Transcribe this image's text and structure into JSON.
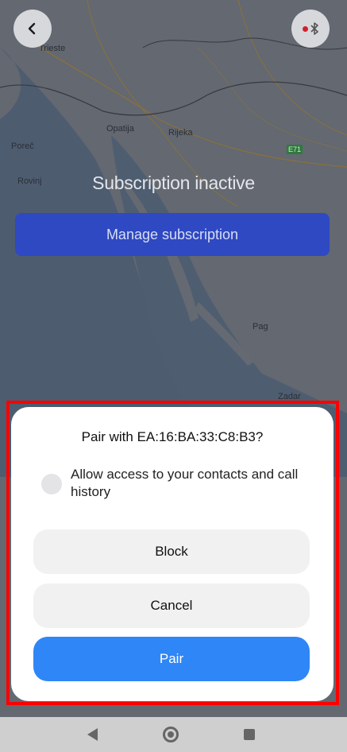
{
  "map": {
    "labels": [
      "Trieste",
      "Opatija",
      "Rijeka",
      "Poreč",
      "Rovinj",
      "Pag",
      "Zadar"
    ],
    "road_badge": "E71"
  },
  "header": {
    "back_icon": "chevron-left-icon",
    "bluetooth_icon": "bluetooth-icon",
    "bluetooth_status_color": "#d0212c"
  },
  "subscription": {
    "status": "Subscription inactive",
    "manage_label": "Manage subscription"
  },
  "dialog": {
    "title": "Pair with EA:16:BA:33:C8:B3?",
    "checkbox_label": "Allow access to your contacts and call history",
    "block_label": "Block",
    "cancel_label": "Cancel",
    "pair_label": "Pair",
    "pair_color": "#2f86f6"
  },
  "navbar": {
    "back": "back-triangle-icon",
    "home": "home-circle-icon",
    "recent": "recents-square-icon"
  }
}
